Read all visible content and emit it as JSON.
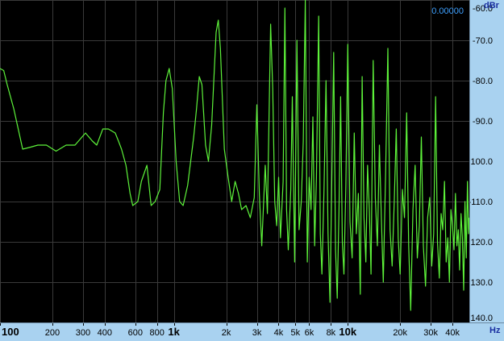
{
  "readout": "0.00000",
  "chart_data": {
    "type": "line",
    "title": "",
    "xlabel": "Hz",
    "ylabel": "dBr",
    "x_scale": "log",
    "xlim": [
      100,
      50000
    ],
    "ylim": [
      -140,
      -60
    ],
    "grid": true,
    "colors": {
      "background": "#000000",
      "line": "#5df23a",
      "grid": "#3a3a3a",
      "axis_panel": "#a9d2f0",
      "axis_text": "#000000",
      "unit_text": "#1a2fa0",
      "readout": "#3ea0ff"
    },
    "x_ticks": [
      {
        "value": 100,
        "label": "100",
        "major": true
      },
      {
        "value": 200,
        "label": "200",
        "major": false
      },
      {
        "value": 300,
        "label": "300",
        "major": false
      },
      {
        "value": 400,
        "label": "400",
        "major": false
      },
      {
        "value": 600,
        "label": "600",
        "major": false
      },
      {
        "value": 800,
        "label": "800",
        "major": false
      },
      {
        "value": 1000,
        "label": "1k",
        "major": true
      },
      {
        "value": 2000,
        "label": "2k",
        "major": false
      },
      {
        "value": 3000,
        "label": "3k",
        "major": false
      },
      {
        "value": 4000,
        "label": "4k",
        "major": false
      },
      {
        "value": 5000,
        "label": "5k",
        "major": false
      },
      {
        "value": 6000,
        "label": "6k",
        "major": false
      },
      {
        "value": 8000,
        "label": "8k",
        "major": false
      },
      {
        "value": 10000,
        "label": "10k",
        "major": true
      },
      {
        "value": 20000,
        "label": "20k",
        "major": false
      },
      {
        "value": 30000,
        "label": "30k",
        "major": false
      },
      {
        "value": 40000,
        "label": "40k",
        "major": false
      }
    ],
    "y_ticks": [
      {
        "value": -60,
        "label": "-60.0"
      },
      {
        "value": -70,
        "label": "-70.0"
      },
      {
        "value": -80,
        "label": "-80.0"
      },
      {
        "value": -90,
        "label": "-90.0"
      },
      {
        "value": -100,
        "label": "-100.0"
      },
      {
        "value": -110,
        "label": "-110.0"
      },
      {
        "value": -120,
        "label": "-120.0"
      },
      {
        "value": -130,
        "label": "-130.0"
      },
      {
        "value": -140,
        "label": "-140.0"
      }
    ],
    "series": [
      {
        "values": [
          [
            100,
            -77
          ],
          [
            105,
            -77.5
          ],
          [
            110,
            -81
          ],
          [
            120,
            -87
          ],
          [
            135,
            -97
          ],
          [
            150,
            -96.5
          ],
          [
            165,
            -96
          ],
          [
            185,
            -96
          ],
          [
            210,
            -97.5
          ],
          [
            240,
            -96
          ],
          [
            270,
            -96
          ],
          [
            310,
            -93
          ],
          [
            340,
            -95
          ],
          [
            360,
            -96
          ],
          [
            390,
            -92
          ],
          [
            420,
            -92
          ],
          [
            460,
            -93
          ],
          [
            480,
            -95
          ],
          [
            500,
            -97
          ],
          [
            530,
            -101
          ],
          [
            560,
            -108
          ],
          [
            580,
            -111
          ],
          [
            620,
            -110
          ],
          [
            650,
            -105
          ],
          [
            700,
            -101
          ],
          [
            740,
            -111
          ],
          [
            780,
            -110
          ],
          [
            830,
            -107
          ],
          [
            870,
            -88
          ],
          [
            900,
            -80
          ],
          [
            940,
            -77
          ],
          [
            980,
            -82
          ],
          [
            1030,
            -100
          ],
          [
            1080,
            -110
          ],
          [
            1130,
            -111
          ],
          [
            1200,
            -106
          ],
          [
            1300,
            -94
          ],
          [
            1350,
            -87
          ],
          [
            1400,
            -79
          ],
          [
            1450,
            -81
          ],
          [
            1520,
            -96
          ],
          [
            1580,
            -100
          ],
          [
            1650,
            -91
          ],
          [
            1750,
            -68
          ],
          [
            1800,
            -65
          ],
          [
            1850,
            -72
          ],
          [
            1950,
            -97
          ],
          [
            2050,
            -104
          ],
          [
            2150,
            -110
          ],
          [
            2250,
            -105
          ],
          [
            2350,
            -108
          ],
          [
            2450,
            -112
          ],
          [
            2600,
            -111
          ],
          [
            2750,
            -114
          ],
          [
            2900,
            -109
          ],
          [
            3000,
            -86
          ],
          [
            3100,
            -108
          ],
          [
            3200,
            -121
          ],
          [
            3350,
            -101
          ],
          [
            3450,
            -113
          ],
          [
            3600,
            -66
          ],
          [
            3700,
            -82
          ],
          [
            3800,
            -110
          ],
          [
            3900,
            -116
          ],
          [
            4000,
            -104
          ],
          [
            4100,
            -119
          ],
          [
            4250,
            -105
          ],
          [
            4350,
            -62
          ],
          [
            4450,
            -112
          ],
          [
            4550,
            -122
          ],
          [
            4700,
            -107
          ],
          [
            4800,
            -84
          ],
          [
            4950,
            -125
          ],
          [
            5100,
            -70
          ],
          [
            5250,
            -117
          ],
          [
            5400,
            -110
          ],
          [
            5550,
            -95
          ],
          [
            5700,
            -60
          ],
          [
            5850,
            -125
          ],
          [
            6000,
            -104
          ],
          [
            6150,
            -112
          ],
          [
            6300,
            -89
          ],
          [
            6450,
            -121
          ],
          [
            6600,
            -104
          ],
          [
            6800,
            -64
          ],
          [
            6950,
            -118
          ],
          [
            7100,
            -128
          ],
          [
            7300,
            -107
          ],
          [
            7500,
            -80
          ],
          [
            7700,
            -118
          ],
          [
            7900,
            -135
          ],
          [
            8100,
            -104
          ],
          [
            8300,
            -73
          ],
          [
            8500,
            -122
          ],
          [
            8700,
            -134
          ],
          [
            8900,
            -112
          ],
          [
            9100,
            -84
          ],
          [
            9300,
            -120
          ],
          [
            9500,
            -128
          ],
          [
            9750,
            -106
          ],
          [
            10000,
            -71
          ],
          [
            10300,
            -115
          ],
          [
            10600,
            -124
          ],
          [
            10900,
            -93
          ],
          [
            11200,
            -118
          ],
          [
            11500,
            -108
          ],
          [
            11800,
            -133
          ],
          [
            12100,
            -79
          ],
          [
            12400,
            -114
          ],
          [
            12700,
            -125
          ],
          [
            13000,
            -101
          ],
          [
            13300,
            -112
          ],
          [
            13600,
            -128
          ],
          [
            14000,
            -75
          ],
          [
            14400,
            -109
          ],
          [
            14800,
            -121
          ],
          [
            15200,
            -96
          ],
          [
            15600,
            -114
          ],
          [
            16000,
            -130
          ],
          [
            16500,
            -103
          ],
          [
            17000,
            -72
          ],
          [
            17500,
            -117
          ],
          [
            18000,
            -126
          ],
          [
            18500,
            -110
          ],
          [
            19000,
            -92
          ],
          [
            19500,
            -119
          ],
          [
            20000,
            -128
          ],
          [
            20600,
            -107
          ],
          [
            21200,
            -114
          ],
          [
            21800,
            -88
          ],
          [
            22400,
            -121
          ],
          [
            23000,
            -137
          ],
          [
            23700,
            -112
          ],
          [
            24400,
            -101
          ],
          [
            25100,
            -124
          ],
          [
            25800,
            -116
          ],
          [
            26500,
            -94
          ],
          [
            27200,
            -121
          ],
          [
            28000,
            -131
          ],
          [
            28800,
            -114
          ],
          [
            29600,
            -109
          ],
          [
            30400,
            -126
          ],
          [
            31200,
            -118
          ],
          [
            32000,
            -84
          ],
          [
            32800,
            -120
          ],
          [
            33600,
            -129
          ],
          [
            34400,
            -113
          ],
          [
            35200,
            -117
          ],
          [
            36000,
            -105
          ],
          [
            36800,
            -125
          ],
          [
            37600,
            -119
          ],
          [
            38400,
            -130
          ],
          [
            39200,
            -112
          ],
          [
            40000,
            -116
          ],
          [
            40800,
            -122
          ],
          [
            41600,
            -108
          ],
          [
            42400,
            -121
          ],
          [
            43200,
            -117
          ],
          [
            44000,
            -127
          ],
          [
            44800,
            -113
          ],
          [
            45600,
            -119
          ],
          [
            46400,
            -132
          ],
          [
            47200,
            -110
          ],
          [
            48000,
            -124
          ],
          [
            48800,
            -105
          ],
          [
            49500,
            -118
          ],
          [
            50000,
            -114
          ]
        ]
      }
    ]
  }
}
